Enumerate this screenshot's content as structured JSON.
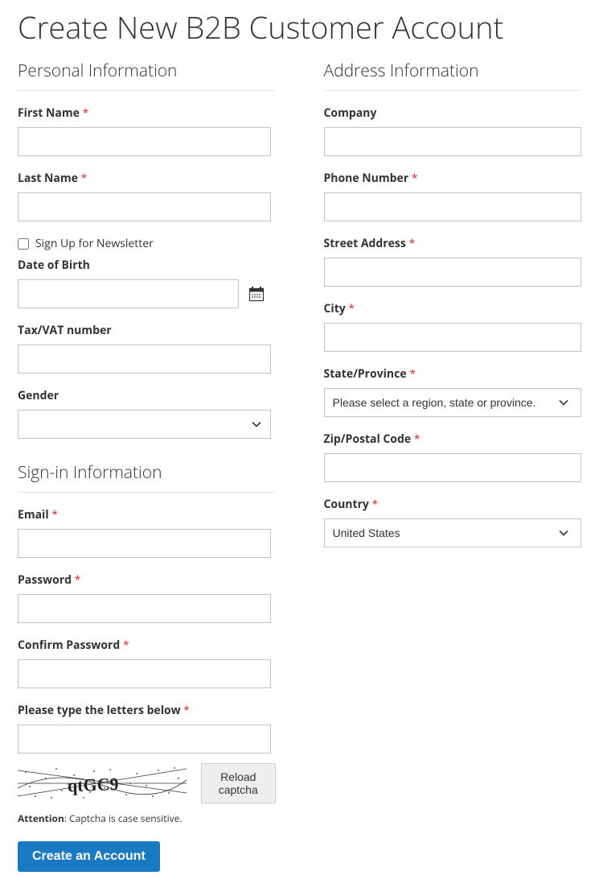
{
  "page": {
    "title": "Create New B2B Customer Account"
  },
  "personal": {
    "legend": "Personal Information",
    "first_name_label": "First Name",
    "last_name_label": "Last Name",
    "newsletter_label": "Sign Up for Newsletter",
    "dob_label": "Date of Birth",
    "taxvat_label": "Tax/VAT number",
    "gender_label": "Gender",
    "gender_value": ""
  },
  "signin": {
    "legend": "Sign-in Information",
    "email_label": "Email",
    "password_label": "Password",
    "confirm_password_label": "Confirm Password",
    "captcha_label": "Please type the letters below",
    "reload_label": "Reload captcha",
    "attention_prefix": "Attention",
    "attention_text": ": Captcha is case sensitive.",
    "captcha_text": "qtGC9",
    "submit_label": "Create an Account"
  },
  "address": {
    "legend": "Address Information",
    "company_label": "Company",
    "phone_label": "Phone Number",
    "street_label": "Street Address",
    "city_label": "City",
    "region_label": "State/Province",
    "region_placeholder": "Please select a region, state or province.",
    "postcode_label": "Zip/Postal Code",
    "country_label": "Country",
    "country_value": "United States"
  }
}
